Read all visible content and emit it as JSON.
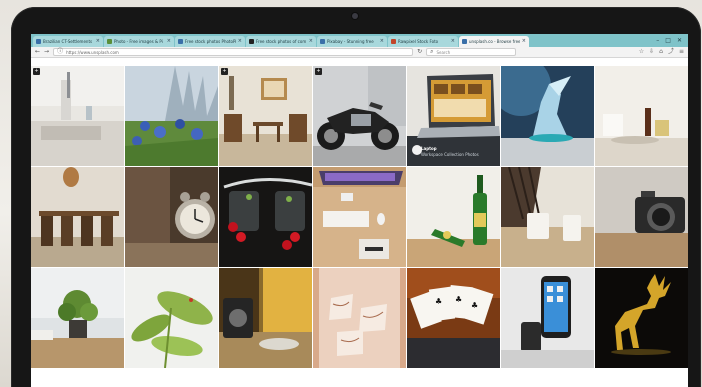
{
  "browser": {
    "tabs": [
      {
        "label": "Brazilian CT-Settlements",
        "active": false
      },
      {
        "label": "Photo - Free images & Pi",
        "active": false
      },
      {
        "label": "Free stock photos  PhotoPin",
        "active": false
      },
      {
        "label": "Free stock photos of com",
        "active": false
      },
      {
        "label": "Pixabay - Stunning free",
        "active": false
      },
      {
        "label": "Rawpixel Stock Foto",
        "active": false
      },
      {
        "label": "unsplash.co - Browse free",
        "active": true
      }
    ],
    "url_text": "https://www.unsplash.com",
    "search_placeholder": "Search",
    "window_controls": [
      "–",
      "□",
      "✕"
    ]
  },
  "gallery": {
    "promo_title": "Laptop",
    "promo_subtitle": "Workspace Collection Photos",
    "photos": [
      "white-kitchen-interior",
      "blue-flowers-field",
      "dining-room-chairs",
      "black-motorcycle",
      "laptop-on-desk",
      "glass-bird-figurine",
      "table-setting",
      "wooden-dining-table",
      "vintage-alarm-clock",
      "glass-jars-cherries",
      "desk-workspace",
      "green-beer-bottles",
      "coffee-mugs-table",
      "vintage-camera",
      "potted-plant",
      "green-leaves-plant",
      "film-camera-rolls",
      "hand-drawn-sketches",
      "playing-cards",
      "smartphone-stand",
      "gold-deer-sculpture"
    ]
  }
}
